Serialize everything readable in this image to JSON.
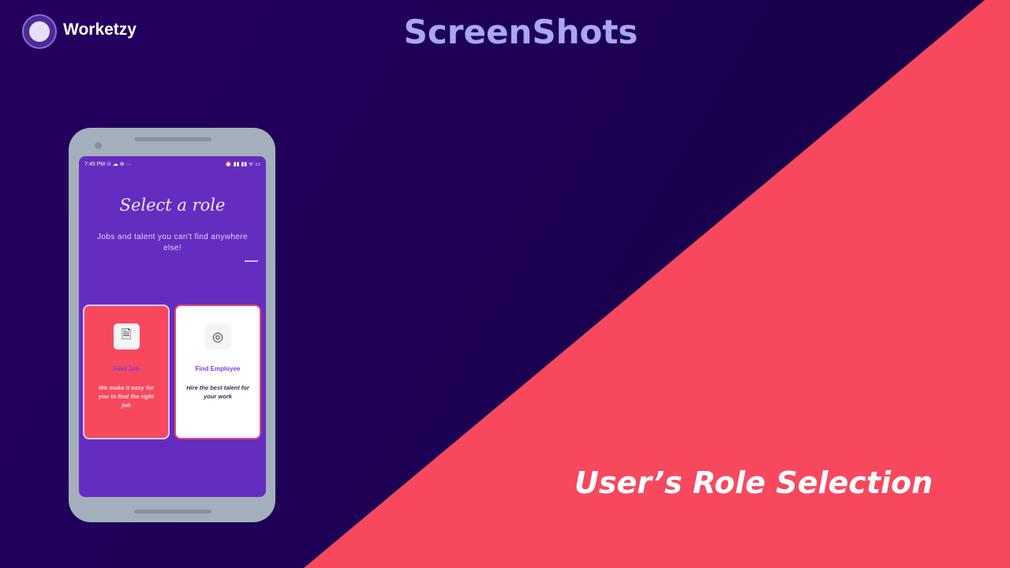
{
  "brand": {
    "name": "Worketzy"
  },
  "header": {
    "title": "ScreenShots"
  },
  "caption": "User’s Role Selection",
  "colors": {
    "background": "#1e0058",
    "accent_red": "#f7485e",
    "title": "#a8a6f5",
    "phone_screen": "#642dc0"
  },
  "phone": {
    "status_bar": {
      "time": "7:45 PM",
      "icons": "⊙ ☁ ⊛ ···",
      "right": "⏰ ▮▮ ▮▮ ᯤ ▭"
    },
    "heading": "Select a role",
    "subtitle": "Jobs and talent you can't find anywhere else!",
    "cards": [
      {
        "title": "Find Job",
        "description": "We make it easy for you to find the right job",
        "icon": "document-icon",
        "selected": true
      },
      {
        "title": "Find Employee",
        "description": "Hire the best talent for your work",
        "icon": "search-person-icon",
        "selected": false
      }
    ]
  }
}
